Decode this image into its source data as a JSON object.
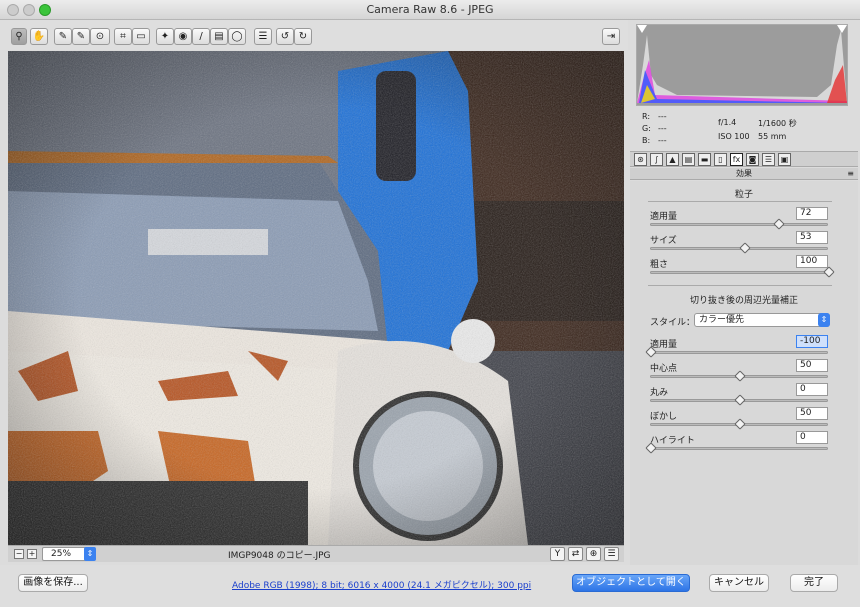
{
  "window": {
    "title": "Camera Raw 8.6  -  JPEG"
  },
  "toolbar": {
    "tools": [
      "zoom-icon",
      "hand-icon",
      "eyedropper-icon",
      "color-sampler-icon",
      "targeted-adjust-icon",
      "crop-icon",
      "straighten-icon",
      "spot-removal-icon",
      "red-eye-icon",
      "adjustment-brush-icon",
      "graduated-filter-icon",
      "radial-filter-icon",
      "preferences-icon",
      "rotate-left-icon",
      "rotate-right-icon"
    ]
  },
  "status": {
    "zoom": "25%",
    "filename": "IMGP9048 のコピー.JPG"
  },
  "histogram": {
    "r": "R:",
    "g": "G:",
    "b": "B:",
    "rv": "---",
    "gv": "---",
    "bv": "---",
    "aperture": "f/1.4",
    "shutter": "1/1600 秒",
    "iso": "ISO 100",
    "focal": "55 mm"
  },
  "panel": {
    "header": "効果",
    "grain": {
      "title": "粒子",
      "rows": [
        {
          "label": "適用量",
          "value": "72",
          "pos": 0.72
        },
        {
          "label": "サイズ",
          "value": "53",
          "pos": 0.53
        },
        {
          "label": "粗さ",
          "value": "100",
          "pos": 1.0
        }
      ]
    },
    "vignette": {
      "title": "切り抜き後の周辺光量補正",
      "style_label": "スタイル：",
      "style_value": "カラー優先",
      "rows": [
        {
          "label": "適用量",
          "value": "-100",
          "pos": 0.0
        },
        {
          "label": "中心点",
          "value": "50",
          "pos": 0.5
        },
        {
          "label": "丸み",
          "value": "0",
          "pos": 0.5
        },
        {
          "label": "ぼかし",
          "value": "50",
          "pos": 0.5
        },
        {
          "label": "ハイライト",
          "value": "0",
          "pos": 0.0
        }
      ]
    }
  },
  "bottom": {
    "save": "画像を保存...",
    "workflow": "Adobe RGB (1998); 8 bit; 6016 x 4000 (24.1 メガピクセル); 300 ppi",
    "open_object": "オブジェクトとして開く",
    "cancel": "キャンセル",
    "done": "完了"
  },
  "colors": {
    "accent": "#3b82f0"
  }
}
